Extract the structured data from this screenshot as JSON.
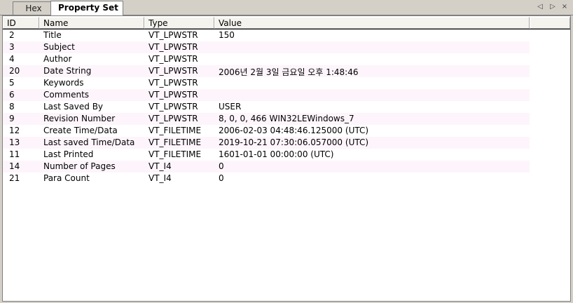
{
  "tabs": {
    "hex": "Hex",
    "property_set": "Property Set"
  },
  "nav": {
    "prev": "◁",
    "next": "▷",
    "close": "×"
  },
  "columns": {
    "id": "ID",
    "name": "Name",
    "type": "Type",
    "value": "Value"
  },
  "rows": [
    {
      "id": "2",
      "name": "Title",
      "type": "VT_LPWSTR",
      "value": "150"
    },
    {
      "id": "3",
      "name": "Subject",
      "type": "VT_LPWSTR",
      "value": ""
    },
    {
      "id": "4",
      "name": "Author",
      "type": "VT_LPWSTR",
      "value": ""
    },
    {
      "id": "20",
      "name": "Date String",
      "type": "VT_LPWSTR",
      "value": "2006년 2월 3일 금요일 오후 1:48:46"
    },
    {
      "id": "5",
      "name": "Keywords",
      "type": "VT_LPWSTR",
      "value": ""
    },
    {
      "id": "6",
      "name": "Comments",
      "type": "VT_LPWSTR",
      "value": ""
    },
    {
      "id": "8",
      "name": "Last Saved By",
      "type": "VT_LPWSTR",
      "value": "USER"
    },
    {
      "id": "9",
      "name": "Revision Number",
      "type": "VT_LPWSTR",
      "value": "8, 0, 0, 466 WIN32LEWindows_7"
    },
    {
      "id": "12",
      "name": "Create Time/Data",
      "type": "VT_FILETIME",
      "value": "2006-02-03 04:48:46.125000 (UTC)"
    },
    {
      "id": "13",
      "name": "Last saved Time/Data",
      "type": "VT_FILETIME",
      "value": "2019-10-21 07:30:06.057000 (UTC)"
    },
    {
      "id": "11",
      "name": "Last Printed",
      "type": "VT_FILETIME",
      "value": "1601-01-01 00:00:00 (UTC)"
    },
    {
      "id": "14",
      "name": "Number of Pages",
      "type": "VT_I4",
      "value": "0"
    },
    {
      "id": "21",
      "name": "Para Count",
      "type": "VT_I4",
      "value": "0"
    }
  ]
}
